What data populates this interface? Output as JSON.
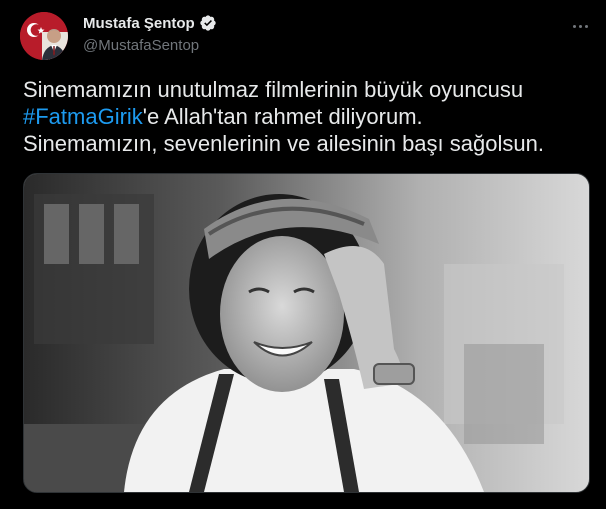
{
  "author": {
    "display_name": "Mustafa Şentop",
    "handle": "@MustafaSentop",
    "verified": true
  },
  "tweet": {
    "line1": "Sinemamızın unutulmaz filmlerinin büyük oyuncusu",
    "hashtag": "#FatmaGirik",
    "line2_rest": "'e Allah'tan rahmet diliyorum.",
    "line3": "Sinemamızın, sevenlerinin ve ailesinin başı sağolsun."
  },
  "icons": {
    "verified": "verified-badge-icon",
    "more": "more-options-icon"
  },
  "colors": {
    "background": "#000000",
    "text": "#e7e9ea",
    "secondary_text": "#71767b",
    "link": "#1d9bf0",
    "verified": "#e7e9ea"
  }
}
